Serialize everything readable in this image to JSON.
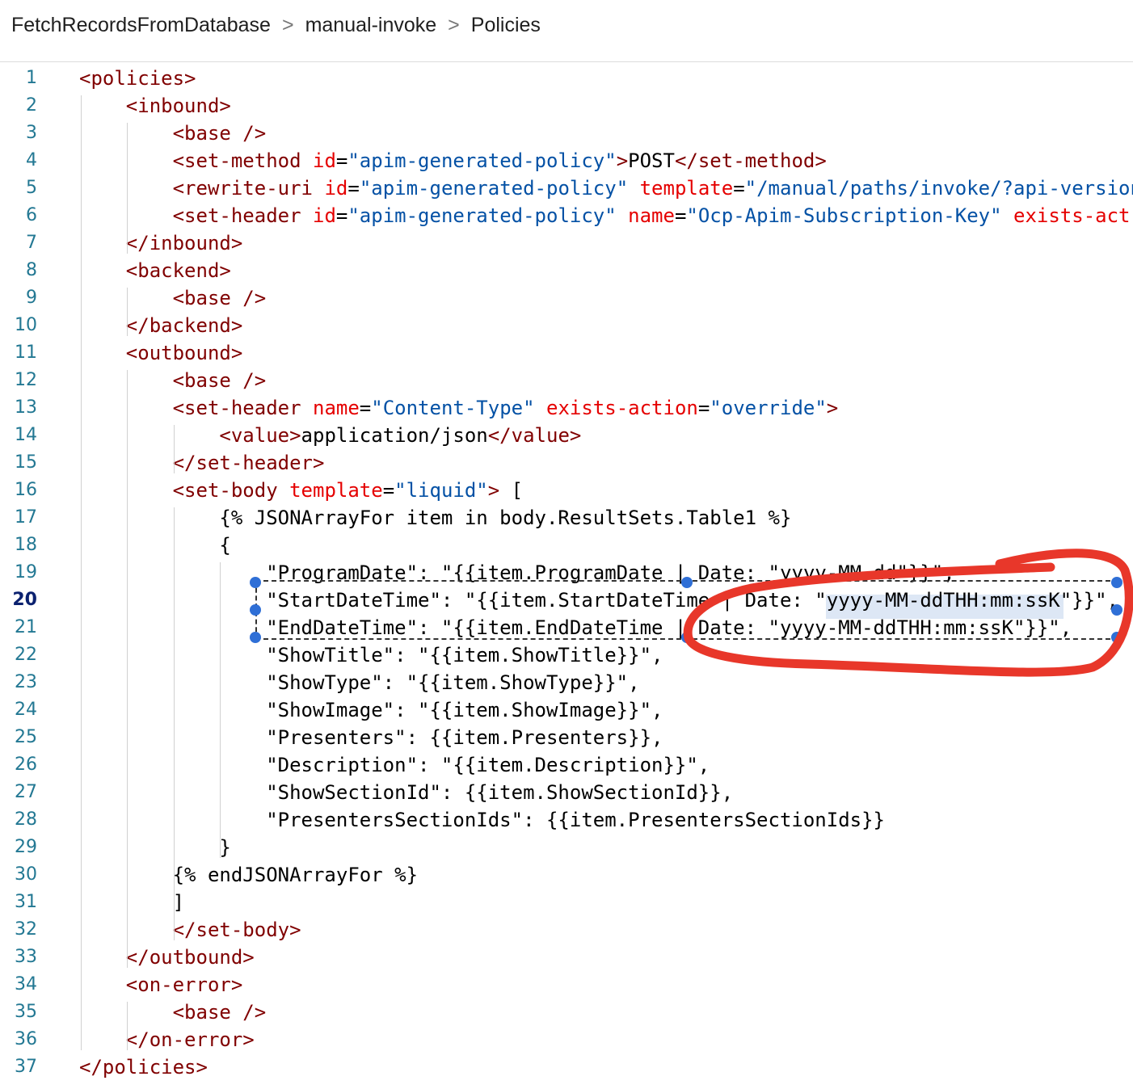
{
  "breadcrumb": {
    "items": [
      "FetchRecordsFromDatabase",
      "manual-invoke",
      "Policies"
    ],
    "separator": ">"
  },
  "editor": {
    "active_line": 20,
    "lines": [
      {
        "n": "1",
        "tokens": [
          [
            "d",
            "<"
          ],
          [
            "t",
            "policies"
          ],
          [
            "d",
            ">"
          ]
        ]
      },
      {
        "n": "2",
        "tokens": [
          [
            "p",
            "    "
          ],
          [
            "d",
            "<"
          ],
          [
            "t",
            "inbound"
          ],
          [
            "d",
            ">"
          ]
        ]
      },
      {
        "n": "3",
        "tokens": [
          [
            "p",
            "        "
          ],
          [
            "d",
            "<"
          ],
          [
            "t",
            "base"
          ],
          [
            "p",
            " "
          ],
          [
            "d",
            "/>"
          ]
        ]
      },
      {
        "n": "4",
        "tokens": [
          [
            "p",
            "        "
          ],
          [
            "d",
            "<"
          ],
          [
            "t",
            "set-method"
          ],
          [
            "p",
            " "
          ],
          [
            "a",
            "id"
          ],
          [
            "p",
            "="
          ],
          [
            "v",
            "\"apim-generated-policy\""
          ],
          [
            "d",
            ">"
          ],
          [
            "p",
            "POST"
          ],
          [
            "d",
            "</"
          ],
          [
            "t",
            "set-method"
          ],
          [
            "d",
            ">"
          ]
        ]
      },
      {
        "n": "5",
        "tokens": [
          [
            "p",
            "        "
          ],
          [
            "d",
            "<"
          ],
          [
            "t",
            "rewrite-uri"
          ],
          [
            "p",
            " "
          ],
          [
            "a",
            "id"
          ],
          [
            "p",
            "="
          ],
          [
            "v",
            "\"apim-generated-policy\""
          ],
          [
            "p",
            " "
          ],
          [
            "a",
            "template"
          ],
          [
            "p",
            "="
          ],
          [
            "v",
            "\"/manual/paths/invoke/?api-version"
          ]
        ]
      },
      {
        "n": "6",
        "tokens": [
          [
            "p",
            "        "
          ],
          [
            "d",
            "<"
          ],
          [
            "t",
            "set-header"
          ],
          [
            "p",
            " "
          ],
          [
            "a",
            "id"
          ],
          [
            "p",
            "="
          ],
          [
            "v",
            "\"apim-generated-policy\""
          ],
          [
            "p",
            " "
          ],
          [
            "a",
            "name"
          ],
          [
            "p",
            "="
          ],
          [
            "v",
            "\"Ocp-Apim-Subscription-Key\""
          ],
          [
            "p",
            " "
          ],
          [
            "a",
            "exists-act"
          ]
        ]
      },
      {
        "n": "7",
        "tokens": [
          [
            "p",
            "    "
          ],
          [
            "d",
            "</"
          ],
          [
            "t",
            "inbound"
          ],
          [
            "d",
            ">"
          ]
        ]
      },
      {
        "n": "8",
        "tokens": [
          [
            "p",
            "    "
          ],
          [
            "d",
            "<"
          ],
          [
            "t",
            "backend"
          ],
          [
            "d",
            ">"
          ]
        ]
      },
      {
        "n": "9",
        "tokens": [
          [
            "p",
            "        "
          ],
          [
            "d",
            "<"
          ],
          [
            "t",
            "base"
          ],
          [
            "p",
            " "
          ],
          [
            "d",
            "/>"
          ]
        ]
      },
      {
        "n": "10",
        "tokens": [
          [
            "p",
            "    "
          ],
          [
            "d",
            "</"
          ],
          [
            "t",
            "backend"
          ],
          [
            "d",
            ">"
          ]
        ]
      },
      {
        "n": "11",
        "tokens": [
          [
            "p",
            "    "
          ],
          [
            "d",
            "<"
          ],
          [
            "t",
            "outbound"
          ],
          [
            "d",
            ">"
          ]
        ]
      },
      {
        "n": "12",
        "tokens": [
          [
            "p",
            "        "
          ],
          [
            "d",
            "<"
          ],
          [
            "t",
            "base"
          ],
          [
            "p",
            " "
          ],
          [
            "d",
            "/>"
          ]
        ]
      },
      {
        "n": "13",
        "tokens": [
          [
            "p",
            "        "
          ],
          [
            "d",
            "<"
          ],
          [
            "t",
            "set-header"
          ],
          [
            "p",
            " "
          ],
          [
            "a",
            "name"
          ],
          [
            "p",
            "="
          ],
          [
            "v",
            "\"Content-Type\""
          ],
          [
            "p",
            " "
          ],
          [
            "a",
            "exists-action"
          ],
          [
            "p",
            "="
          ],
          [
            "v",
            "\"override\""
          ],
          [
            "d",
            ">"
          ]
        ]
      },
      {
        "n": "14",
        "tokens": [
          [
            "p",
            "            "
          ],
          [
            "d",
            "<"
          ],
          [
            "t",
            "value"
          ],
          [
            "d",
            ">"
          ],
          [
            "p",
            "application/json"
          ],
          [
            "d",
            "</"
          ],
          [
            "t",
            "value"
          ],
          [
            "d",
            ">"
          ]
        ]
      },
      {
        "n": "15",
        "tokens": [
          [
            "p",
            "        "
          ],
          [
            "d",
            "</"
          ],
          [
            "t",
            "set-header"
          ],
          [
            "d",
            ">"
          ]
        ]
      },
      {
        "n": "16",
        "tokens": [
          [
            "p",
            "        "
          ],
          [
            "d",
            "<"
          ],
          [
            "t",
            "set-body"
          ],
          [
            "p",
            " "
          ],
          [
            "a",
            "template"
          ],
          [
            "p",
            "="
          ],
          [
            "v",
            "\"liquid\""
          ],
          [
            "d",
            ">"
          ],
          [
            "p",
            " ["
          ]
        ]
      },
      {
        "n": "17",
        "tokens": [
          [
            "p",
            "            {% JSONArrayFor item in body.ResultSets.Table1 %}"
          ]
        ]
      },
      {
        "n": "18",
        "tokens": [
          [
            "p",
            "            {"
          ]
        ]
      },
      {
        "n": "19",
        "tokens": [
          [
            "p",
            "                \"ProgramDate\": \"{{item.ProgramDate | Date: \"yyyy-MM-dd\"}}\","
          ]
        ]
      },
      {
        "n": "20",
        "tokens": [
          [
            "p",
            "                \"StartDateTime\": \"{{item.StartDateTime | Date: \"yyyy-MM-ddTHH:mm:ssK\"}}\","
          ]
        ]
      },
      {
        "n": "21",
        "tokens": [
          [
            "p",
            "                \"EndDateTime\": \"{{item.EndDateTime | Date: \"yyyy-MM-ddTHH:mm:ssK\"}}\","
          ]
        ]
      },
      {
        "n": "22",
        "tokens": [
          [
            "p",
            "                \"ShowTitle\": \"{{item.ShowTitle}}\","
          ]
        ]
      },
      {
        "n": "23",
        "tokens": [
          [
            "p",
            "                \"ShowType\": \"{{item.ShowType}}\","
          ]
        ]
      },
      {
        "n": "24",
        "tokens": [
          [
            "p",
            "                \"ShowImage\": \"{{item.ShowImage}}\","
          ]
        ]
      },
      {
        "n": "25",
        "tokens": [
          [
            "p",
            "                \"Presenters\": {{item.Presenters}},"
          ]
        ]
      },
      {
        "n": "26",
        "tokens": [
          [
            "p",
            "                \"Description\": \"{{item.Description}}\","
          ]
        ]
      },
      {
        "n": "27",
        "tokens": [
          [
            "p",
            "                \"ShowSectionId\": {{item.ShowSectionId}},"
          ]
        ]
      },
      {
        "n": "28",
        "tokens": [
          [
            "p",
            "                \"PresentersSectionIds\": {{item.PresentersSectionIds}}"
          ]
        ]
      },
      {
        "n": "29",
        "tokens": [
          [
            "p",
            "            }"
          ]
        ]
      },
      {
        "n": "30",
        "tokens": [
          [
            "p",
            "        {% endJSONArrayFor %}"
          ]
        ]
      },
      {
        "n": "31",
        "tokens": [
          [
            "p",
            "        ]"
          ]
        ]
      },
      {
        "n": "32",
        "tokens": [
          [
            "p",
            "        "
          ],
          [
            "d",
            "</"
          ],
          [
            "t",
            "set-body"
          ],
          [
            "d",
            ">"
          ]
        ]
      },
      {
        "n": "33",
        "tokens": [
          [
            "p",
            "    "
          ],
          [
            "d",
            "</"
          ],
          [
            "t",
            "outbound"
          ],
          [
            "d",
            ">"
          ]
        ]
      },
      {
        "n": "34",
        "tokens": [
          [
            "p",
            "    "
          ],
          [
            "d",
            "<"
          ],
          [
            "t",
            "on-error"
          ],
          [
            "d",
            ">"
          ]
        ]
      },
      {
        "n": "35",
        "tokens": [
          [
            "p",
            "        "
          ],
          [
            "d",
            "<"
          ],
          [
            "t",
            "base"
          ],
          [
            "p",
            " "
          ],
          [
            "d",
            "/>"
          ]
        ]
      },
      {
        "n": "36",
        "tokens": [
          [
            "p",
            "    "
          ],
          [
            "d",
            "</"
          ],
          [
            "t",
            "on-error"
          ],
          [
            "d",
            ">"
          ]
        ]
      },
      {
        "n": "37",
        "tokens": [
          [
            "d",
            "</"
          ],
          [
            "t",
            "policies"
          ],
          [
            "d",
            ">"
          ]
        ]
      }
    ]
  },
  "annotation": {
    "color": "#e8372a",
    "shape": "freehand-ellipse"
  },
  "colors": {
    "tag": "#800000",
    "attribute": "#e50000",
    "string": "#0451a5",
    "line_number": "#237893",
    "selection_handle": "#2f6fd6"
  }
}
